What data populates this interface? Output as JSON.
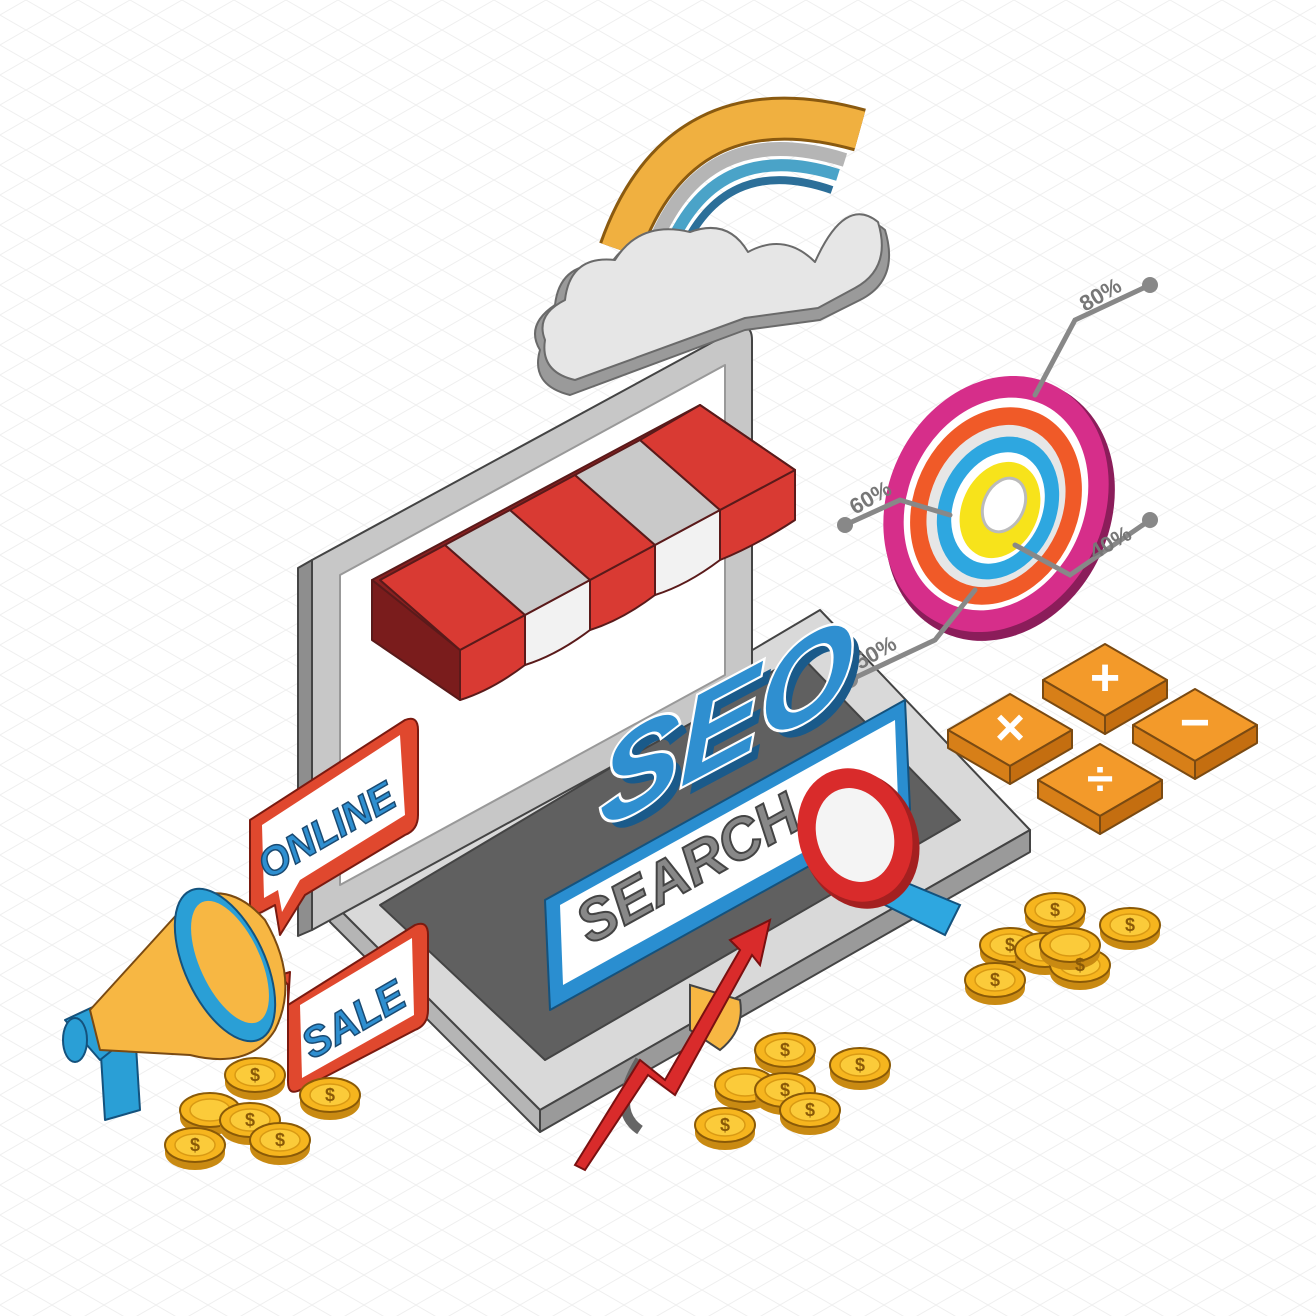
{
  "labels": {
    "seo": "SEO",
    "search": "SEARCH",
    "online": "ONLINE",
    "sale": "SALE",
    "p80": "80%",
    "p60": "60%",
    "p40": "40%",
    "p50": "50%"
  },
  "calculator": {
    "plus": "+",
    "times": "×",
    "minus": "−",
    "divide": "÷"
  },
  "coin_symbol": "$",
  "colors": {
    "background": "#ffffff",
    "grid": "#eeeeee",
    "laptop_frame": "#c7c7c7",
    "laptop_dark": "#5f5f5f",
    "awning_red": "#d93a33",
    "awning_white": "#f2f2f2",
    "seo_blue": "#2f8fd0",
    "bubble_red": "#e0482e",
    "megaphone_yellow": "#f7b743",
    "megaphone_blue": "#2a9fd6",
    "calc_orange": "#f39a2a",
    "coin_gold": "#f6b51e",
    "rainbow_outer": "#f0b040",
    "ring_magenta": "#d62e8a",
    "ring_orange": "#f05a28",
    "ring_blue": "#2ea7e0",
    "ring_yellow": "#f7e31b",
    "arrow_red": "#d92b2b"
  }
}
